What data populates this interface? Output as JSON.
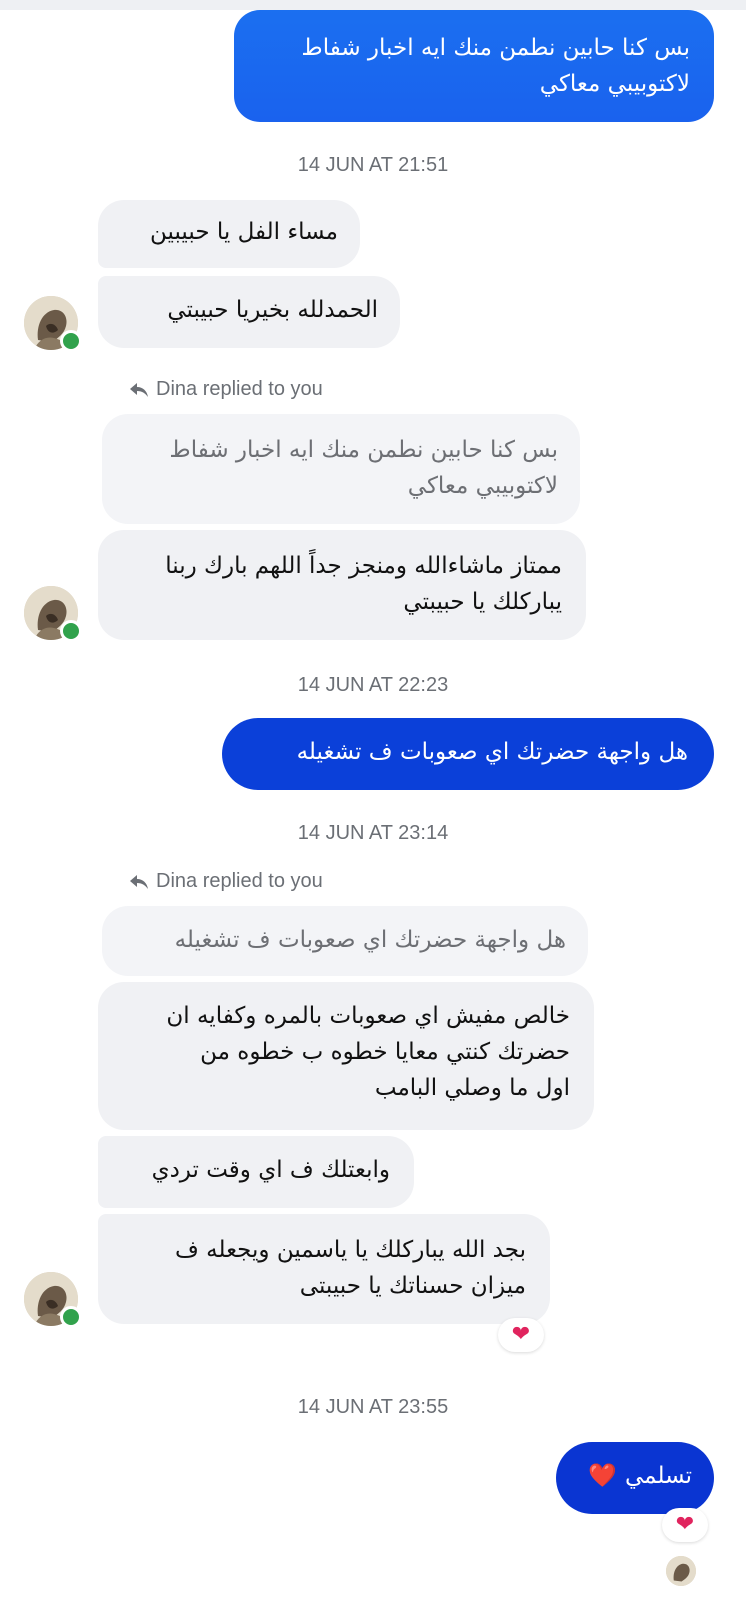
{
  "conversation": {
    "contact_status_color": "#31a24c",
    "messages": [
      {
        "text": "بس كنا حابين نطمن منك ايه اخبار شفاط\nلاكتوبيبي معاكي"
      },
      {
        "text": "مساء الفل يا حبيبين"
      },
      {
        "text": "الحمدلله بخيريا حبيبتي"
      },
      {
        "text": "بس كنا حابين نطمن منك ايه اخبار شفاط\nلاكتوبيبي معاكي"
      },
      {
        "text": "ممتاز ماشاءالله ومنجز جداً اللهم بارك ربنا\nيباركلك يا حبيبتي"
      },
      {
        "text": "هل واجهة حضرتك اي صعوبات ف تشغيله"
      },
      {
        "text": "هل واجهة حضرتك اي صعوبات ف تشغيله"
      },
      {
        "text": "خالص مفيش اي صعوبات بالمره وكفايه ان\nحضرتك كنتي معايا خطوه ب خطوه من\nاول ما وصلي البامب"
      },
      {
        "text": "وابعتلك ف اي وقت تردي"
      },
      {
        "text": "بجد الله يباركلك يا ياسمين ويجعله ف\nميزان حسناتك يا حبيبتى"
      },
      {
        "text": "تسلمي",
        "emoji": "❤️"
      }
    ],
    "timestamps": [
      "14 JUN AT 21:51",
      "14 JUN AT 22:23",
      "14 JUN AT 23:14",
      "14 JUN AT 23:55"
    ],
    "reply_notices": [
      "Dina replied to you",
      "Dina replied to you"
    ],
    "reactions": [
      "❤",
      "❤"
    ]
  },
  "colors": {
    "outgoing_gradient_top": "#1877f2",
    "outgoing_gradient_bottom": "#0a2fd4",
    "incoming_bubble": "#f0f1f4",
    "online_dot": "#31a24c",
    "heart": "#e0245e"
  }
}
